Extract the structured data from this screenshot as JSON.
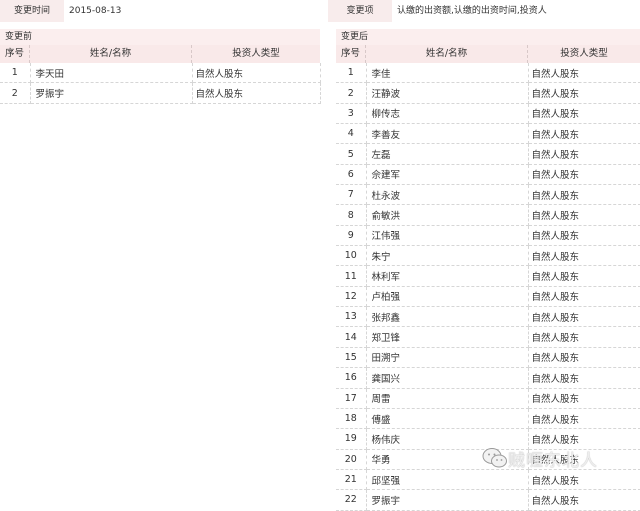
{
  "header": {
    "change_time_label": "变更时间",
    "change_time_value": "2015-08-13",
    "change_item_label": "变更项",
    "change_item_value": "认缴的出资额,认缴的出资时间,投资人"
  },
  "before": {
    "title": "变更前",
    "columns": {
      "index": "序号",
      "name": "姓名/名称",
      "type": "投资人类型"
    },
    "rows": [
      {
        "index": "1",
        "name": "李天田",
        "type": "自然人股东"
      },
      {
        "index": "2",
        "name": "罗振宇",
        "type": "自然人股东"
      }
    ]
  },
  "after": {
    "title": "变更后",
    "columns": {
      "index": "序号",
      "name": "姓名/名称",
      "type": "投资人类型"
    },
    "rows": [
      {
        "index": "1",
        "name": "李佳",
        "type": "自然人股东"
      },
      {
        "index": "2",
        "name": "汪静波",
        "type": "自然人股东"
      },
      {
        "index": "3",
        "name": "柳传志",
        "type": "自然人股东"
      },
      {
        "index": "4",
        "name": "李善友",
        "type": "自然人股东"
      },
      {
        "index": "5",
        "name": "左磊",
        "type": "自然人股东"
      },
      {
        "index": "6",
        "name": "佘建军",
        "type": "自然人股东"
      },
      {
        "index": "7",
        "name": "杜永波",
        "type": "自然人股东"
      },
      {
        "index": "8",
        "name": "俞敏洪",
        "type": "自然人股东"
      },
      {
        "index": "9",
        "name": "江伟强",
        "type": "自然人股东"
      },
      {
        "index": "10",
        "name": "朱宁",
        "type": "自然人股东"
      },
      {
        "index": "11",
        "name": "林利军",
        "type": "自然人股东"
      },
      {
        "index": "12",
        "name": "卢柏强",
        "type": "自然人股东"
      },
      {
        "index": "13",
        "name": "张邦鑫",
        "type": "自然人股东"
      },
      {
        "index": "14",
        "name": "郑卫锋",
        "type": "自然人股东"
      },
      {
        "index": "15",
        "name": "田溯宁",
        "type": "自然人股东"
      },
      {
        "index": "16",
        "name": "龚国兴",
        "type": "自然人股东"
      },
      {
        "index": "17",
        "name": "周雷",
        "type": "自然人股东"
      },
      {
        "index": "18",
        "name": "傅盛",
        "type": "自然人股东"
      },
      {
        "index": "19",
        "name": "杨伟庆",
        "type": "自然人股东"
      },
      {
        "index": "20",
        "name": "华勇",
        "type": "自然人股东"
      },
      {
        "index": "21",
        "name": "邱坚强",
        "type": "自然人股东"
      },
      {
        "index": "22",
        "name": "罗振宇",
        "type": "自然人股东"
      }
    ]
  },
  "watermark": {
    "text": "贼喱东北人",
    "icon": "wechat-icon"
  }
}
